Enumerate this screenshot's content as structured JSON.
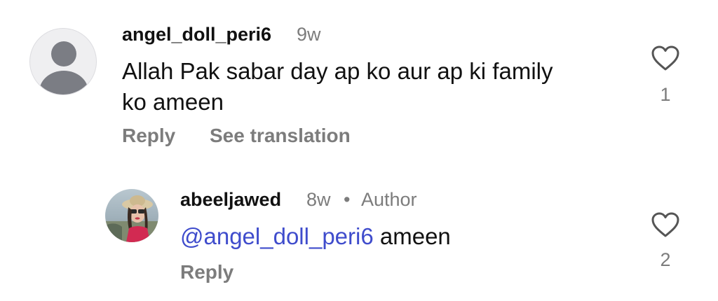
{
  "comments": [
    {
      "username": "angel_doll_peri6",
      "time": "9w",
      "text_line1": "Allah Pak sabar day ap ko aur ap ki family",
      "text_line2": "ko ameen",
      "reply_label": "Reply",
      "translate_label": "See translation",
      "likes": "1",
      "avatar_icon": "default-user-avatar",
      "like_icon": "heart-outline-icon"
    }
  ],
  "replies": [
    {
      "username": "abeeljawed",
      "time": "8w",
      "separator": "•",
      "author_badge": "Author",
      "mention": "@angel_doll_peri6",
      "text": " ameen",
      "reply_label": "Reply",
      "likes": "2",
      "like_icon": "heart-outline-icon"
    }
  ],
  "colors": {
    "mention": "#3f4ccc",
    "meta": "#7c7c7c",
    "text": "#111111"
  }
}
